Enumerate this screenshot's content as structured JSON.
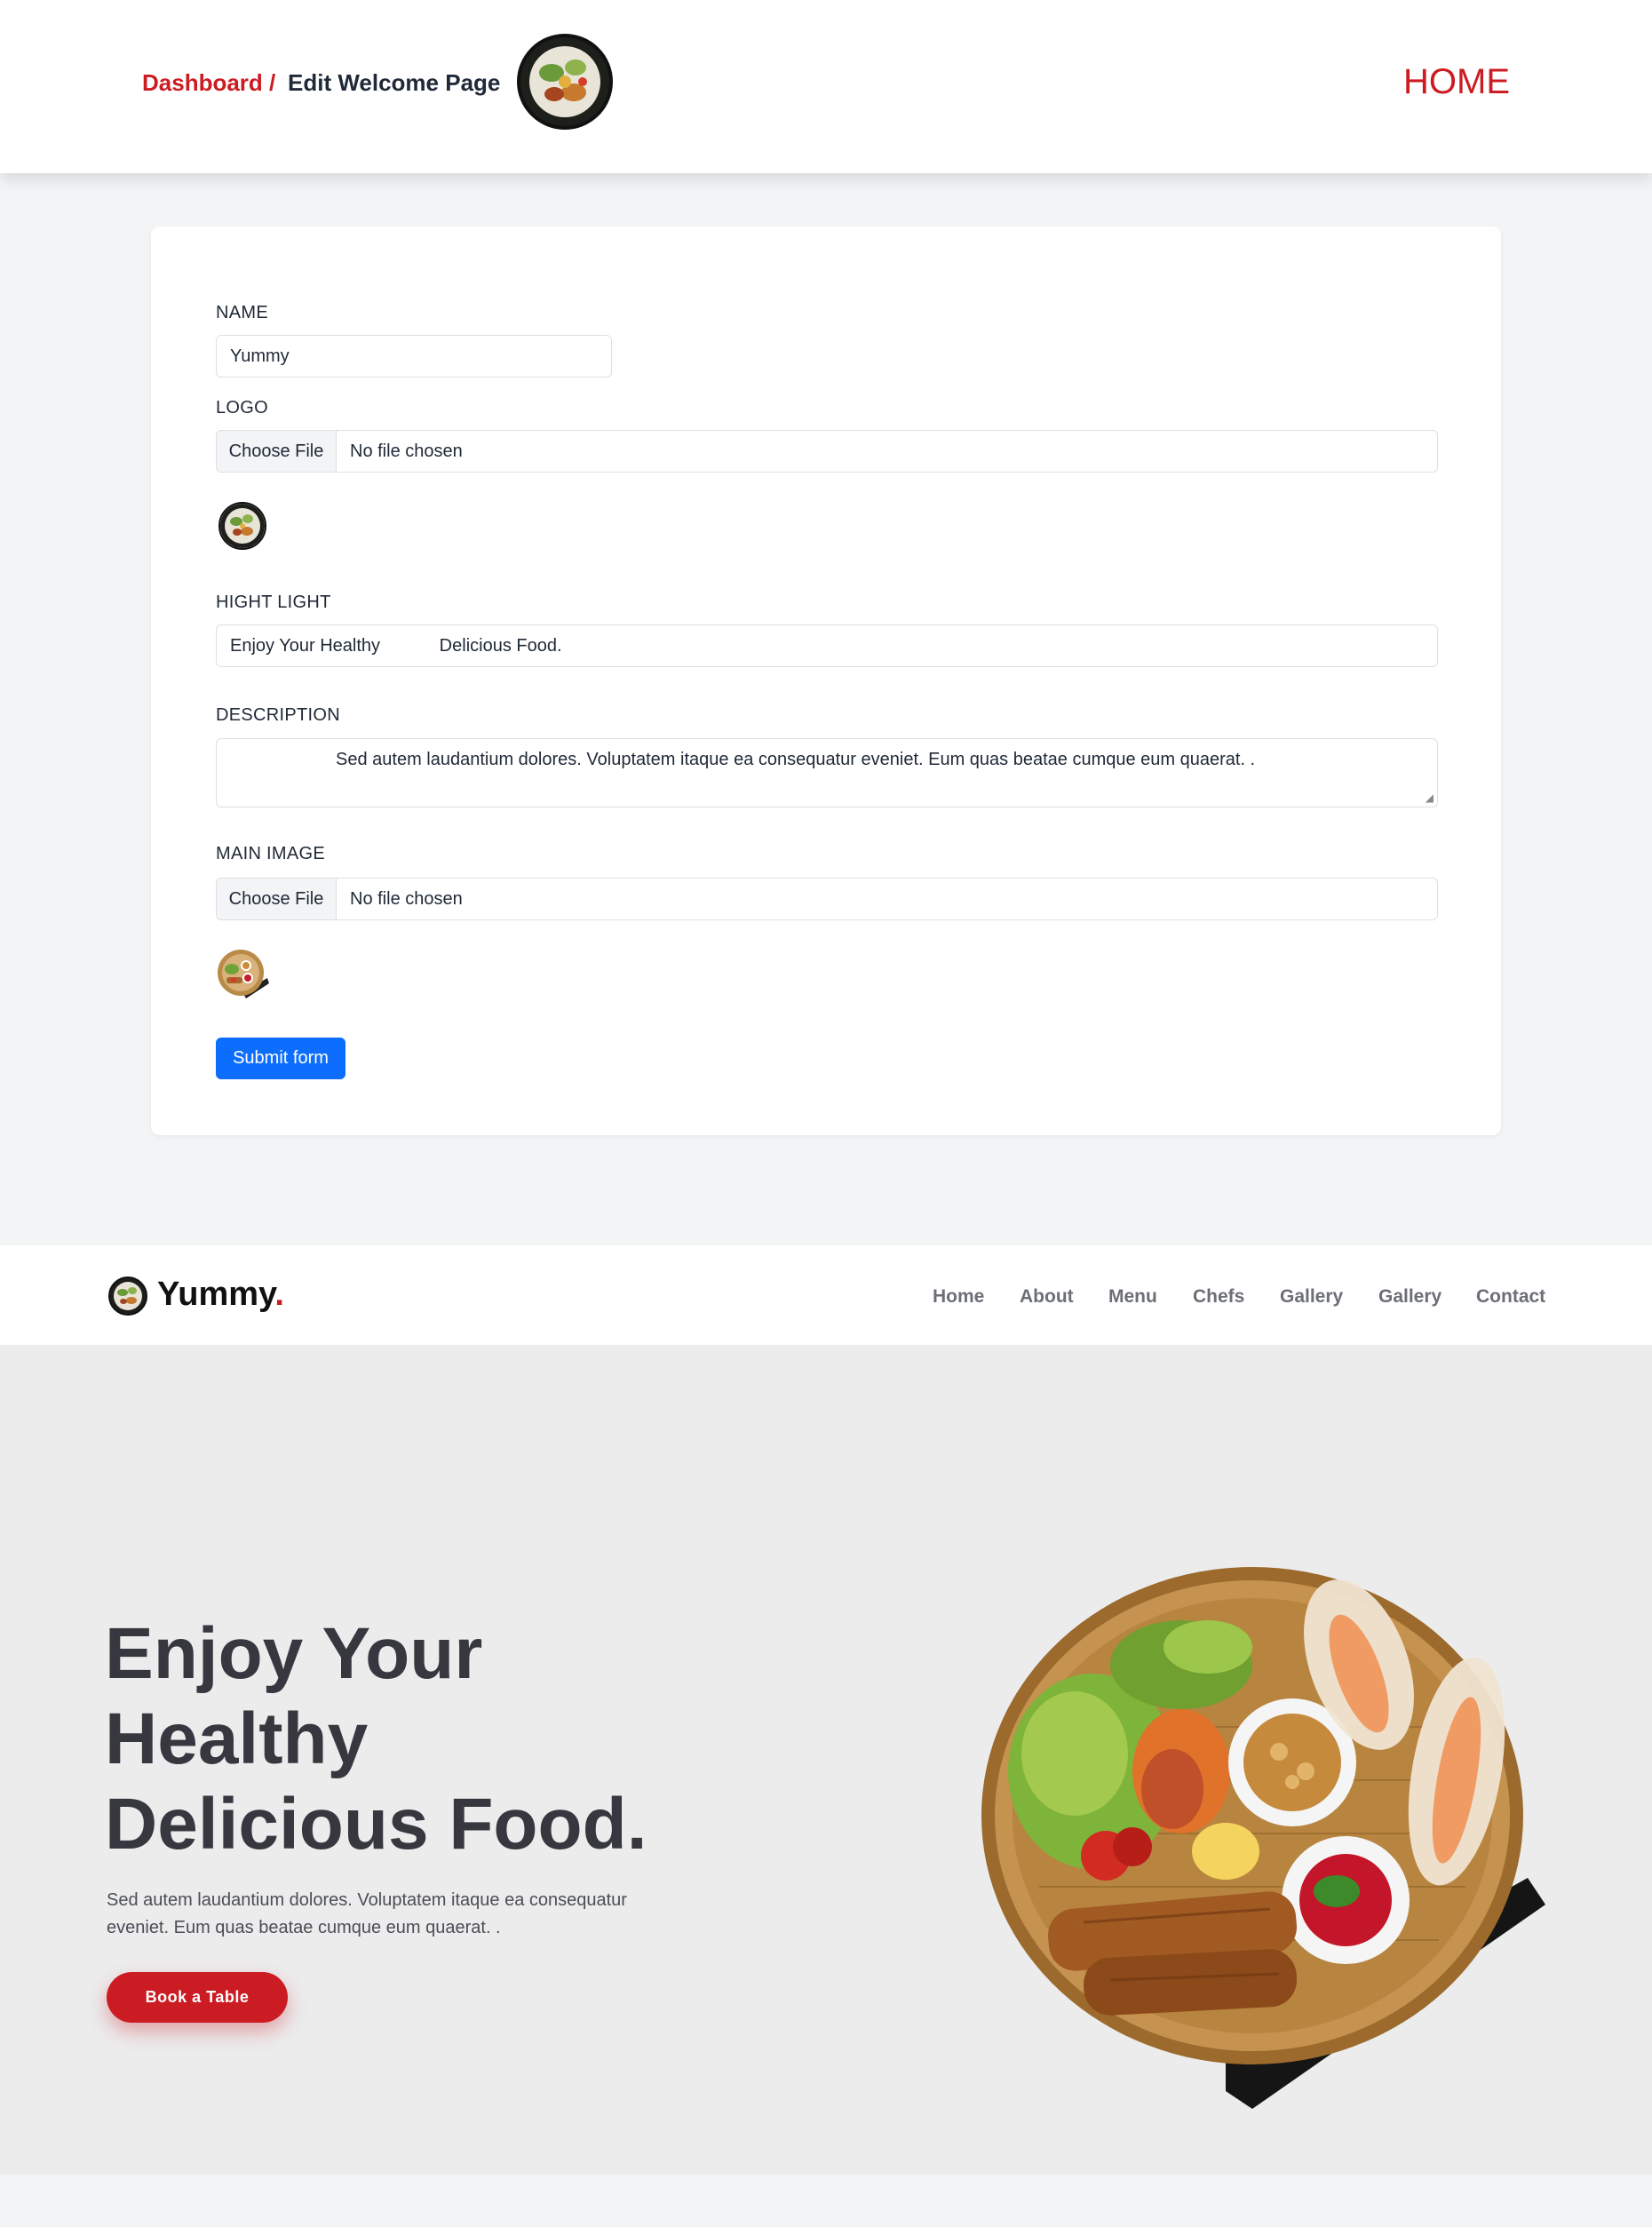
{
  "header": {
    "breadcrumb_link": "Dashboard /",
    "breadcrumb_current": "Edit Welcome Page",
    "home_link": "HOME"
  },
  "form": {
    "name_label": "NAME",
    "name_value": "Yummy",
    "logo_label": "LOGO",
    "logo_choose_button": "Choose File",
    "logo_file_status": "No file chosen",
    "highlight_label": "HIGHT LIGHT",
    "highlight_value": "Enjoy Your Healthy            Delicious Food.",
    "description_label": "DESCRIPTION",
    "description_value": "Sed autem laudantium dolores. Voluptatem itaque ea consequatur eveniet. Eum quas beatae cumque eum quaerat. .",
    "main_image_label": "MAIN IMAGE",
    "main_image_choose_button": "Choose File",
    "main_image_file_status": "No file chosen",
    "submit_label": "Submit form"
  },
  "site_nav": {
    "brand": "Yummy",
    "brand_dot": ".",
    "links": [
      "Home",
      "About",
      "Menu",
      "Chefs",
      "Gallery",
      "Gallery",
      "Contact"
    ]
  },
  "hero": {
    "title_line1": "Enjoy Your",
    "title_line2": "Healthy",
    "title_line3": "Delicious Food.",
    "description": "Sed autem laudantium dolores. Voluptatem itaque ea consequatur eveniet. Eum quas beatae cumque eum quaerat. .",
    "cta_label": "Book a Table"
  },
  "colors": {
    "accent_red": "#cc1c23",
    "primary_blue": "#0d6efd",
    "hero_bg": "#ececed",
    "page_bg": "#f3f4f6"
  },
  "icons": [
    "food-plate-logo-icon",
    "food-basket-image"
  ]
}
